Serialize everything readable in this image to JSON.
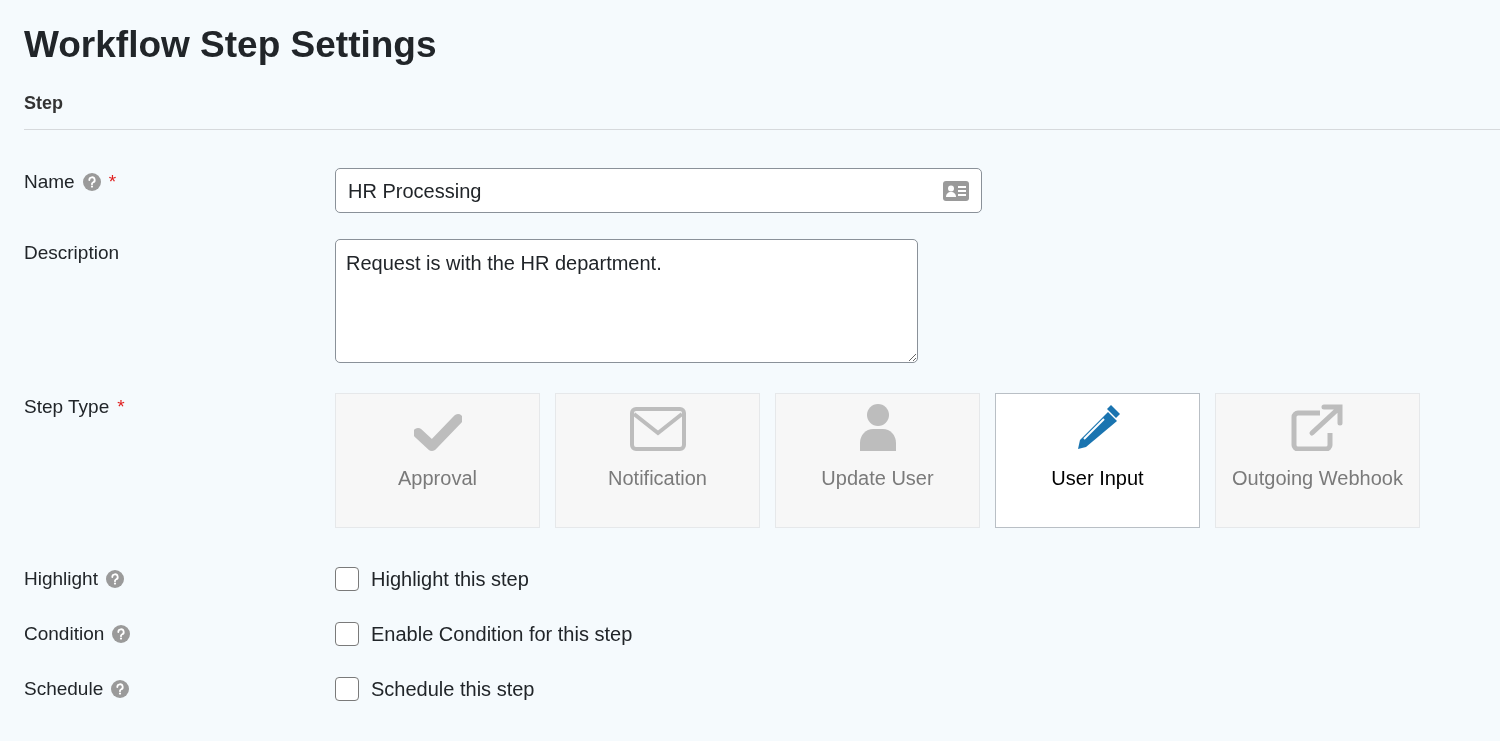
{
  "title": "Workflow Step Settings",
  "section": "Step",
  "name_field": {
    "label": "Name",
    "help": true,
    "required_marker": "*",
    "value": "HR Processing"
  },
  "description_field": {
    "label": "Description",
    "value": "Request is with the HR department."
  },
  "step_type": {
    "label": "Step Type",
    "required_marker": "*",
    "options": [
      {
        "kind": "approval",
        "label": "Approval",
        "selected": false
      },
      {
        "kind": "notification",
        "label": "Notification",
        "selected": false
      },
      {
        "kind": "user",
        "label": "Update User",
        "selected": false
      },
      {
        "kind": "input",
        "label": "User Input",
        "selected": true
      },
      {
        "kind": "webhook",
        "label": "Outgoing Webhook",
        "selected": false
      }
    ]
  },
  "options": [
    {
      "label": "Highlight",
      "help": true,
      "text": "Highlight this step",
      "checked": false
    },
    {
      "label": "Condition",
      "help": true,
      "text": "Enable Condition for this step",
      "checked": false
    },
    {
      "label": "Schedule",
      "help": true,
      "text": "Schedule this step",
      "checked": false
    }
  ]
}
